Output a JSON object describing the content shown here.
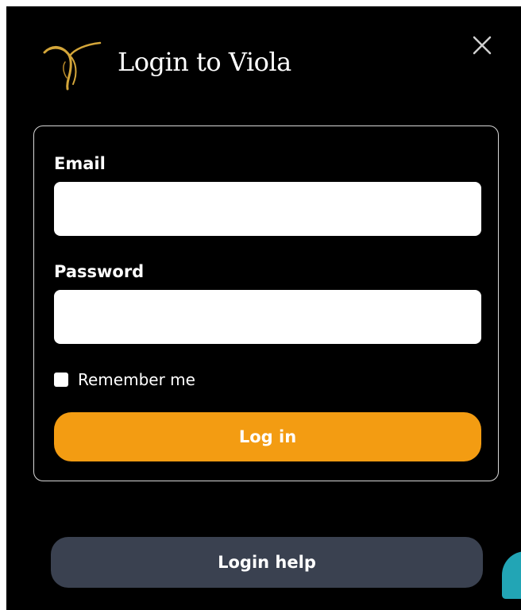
{
  "dialog": {
    "title": "Login to Viola",
    "close_icon": "close-icon",
    "logo_icon": "viola-logo-icon"
  },
  "form": {
    "email_label": "Email",
    "email_value": "",
    "password_label": "Password",
    "password_value": "",
    "remember_label": "Remember me",
    "remember_checked": false,
    "login_label": "Log in"
  },
  "footer": {
    "help_label": "Login help",
    "chat_icon": "chat-bubble-icon"
  },
  "colors": {
    "background": "#000000",
    "primary": "#f39c12",
    "secondary": "#3a4150",
    "logo": "#d4a63a",
    "chat": "#22a5b5"
  }
}
